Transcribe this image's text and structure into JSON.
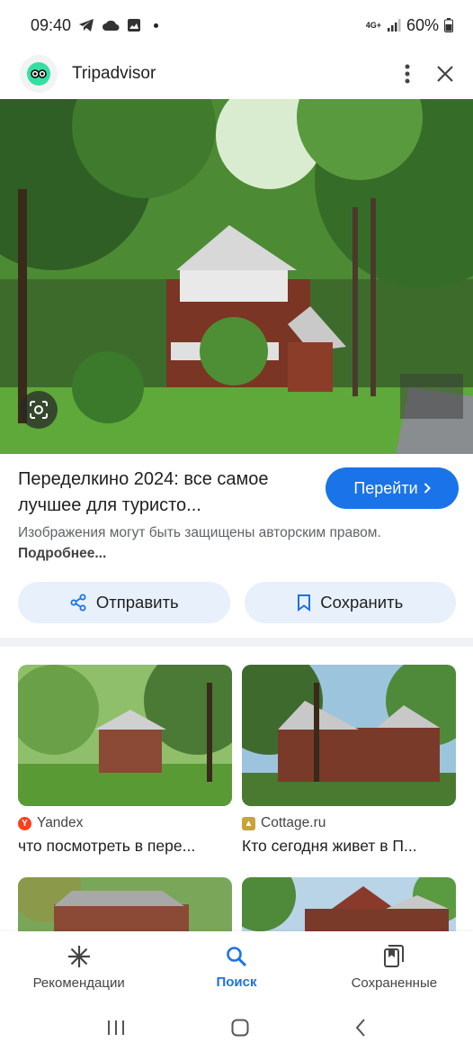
{
  "status": {
    "time": "09:40",
    "network": "4G+",
    "battery": "60%"
  },
  "header": {
    "site_name": "Tripadvisor"
  },
  "result": {
    "title": "Переделкино 2024: все самое лучшее для туристо...",
    "go_label": "Перейти",
    "copyright_text": "Изображения могут быть защищены авторским правом.",
    "copyright_link": "Подробнее..."
  },
  "actions": {
    "share_label": "Отправить",
    "save_label": "Сохранить"
  },
  "related": [
    {
      "source": "Yandex",
      "caption": "что посмотреть в пере..."
    },
    {
      "source": "Cottage.ru",
      "caption": "Кто сегодня живет в П..."
    }
  ],
  "bottom_nav": {
    "recommendations": "Рекомендации",
    "search": "Поиск",
    "saved": "Сохраненные"
  },
  "colors": {
    "accent": "#1a73e8",
    "pill_bg": "#e8f0fb",
    "tripadvisor_green": "#34e0a1"
  }
}
